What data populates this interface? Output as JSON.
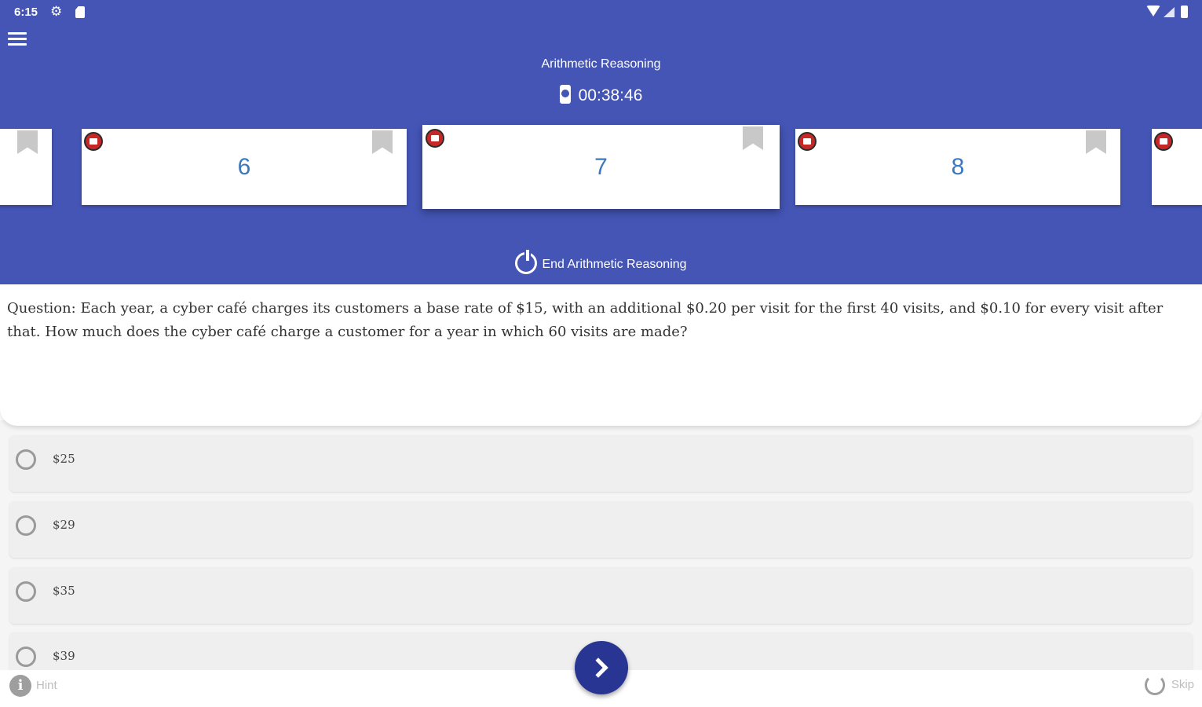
{
  "status_bar": {
    "time": "6:15"
  },
  "header": {
    "section_title": "Arithmetic Reasoning",
    "timer": "00:38:46",
    "end_label": "End Arithmetic Reasoning"
  },
  "question_cards": [
    {
      "number": ""
    },
    {
      "number": "6"
    },
    {
      "number": "7",
      "current": true
    },
    {
      "number": "8"
    },
    {
      "number": ""
    }
  ],
  "question": {
    "text": "Question: Each year, a cyber café charges its customers a base rate of $15, with an additional $0.20 per visit for the first 40 visits, and $0.10 for every visit after that. How much does the cyber café charge a customer for a year in which 60 visits are made?"
  },
  "answers": [
    {
      "label": "$25"
    },
    {
      "label": "$29"
    },
    {
      "label": "$35"
    },
    {
      "label": "$39"
    }
  ],
  "footer": {
    "hint_label": "Hint",
    "skip_label": "Skip"
  },
  "colors": {
    "header_bg": "#4455b5",
    "next_button": "#283593",
    "card_number": "#3a78c0"
  }
}
